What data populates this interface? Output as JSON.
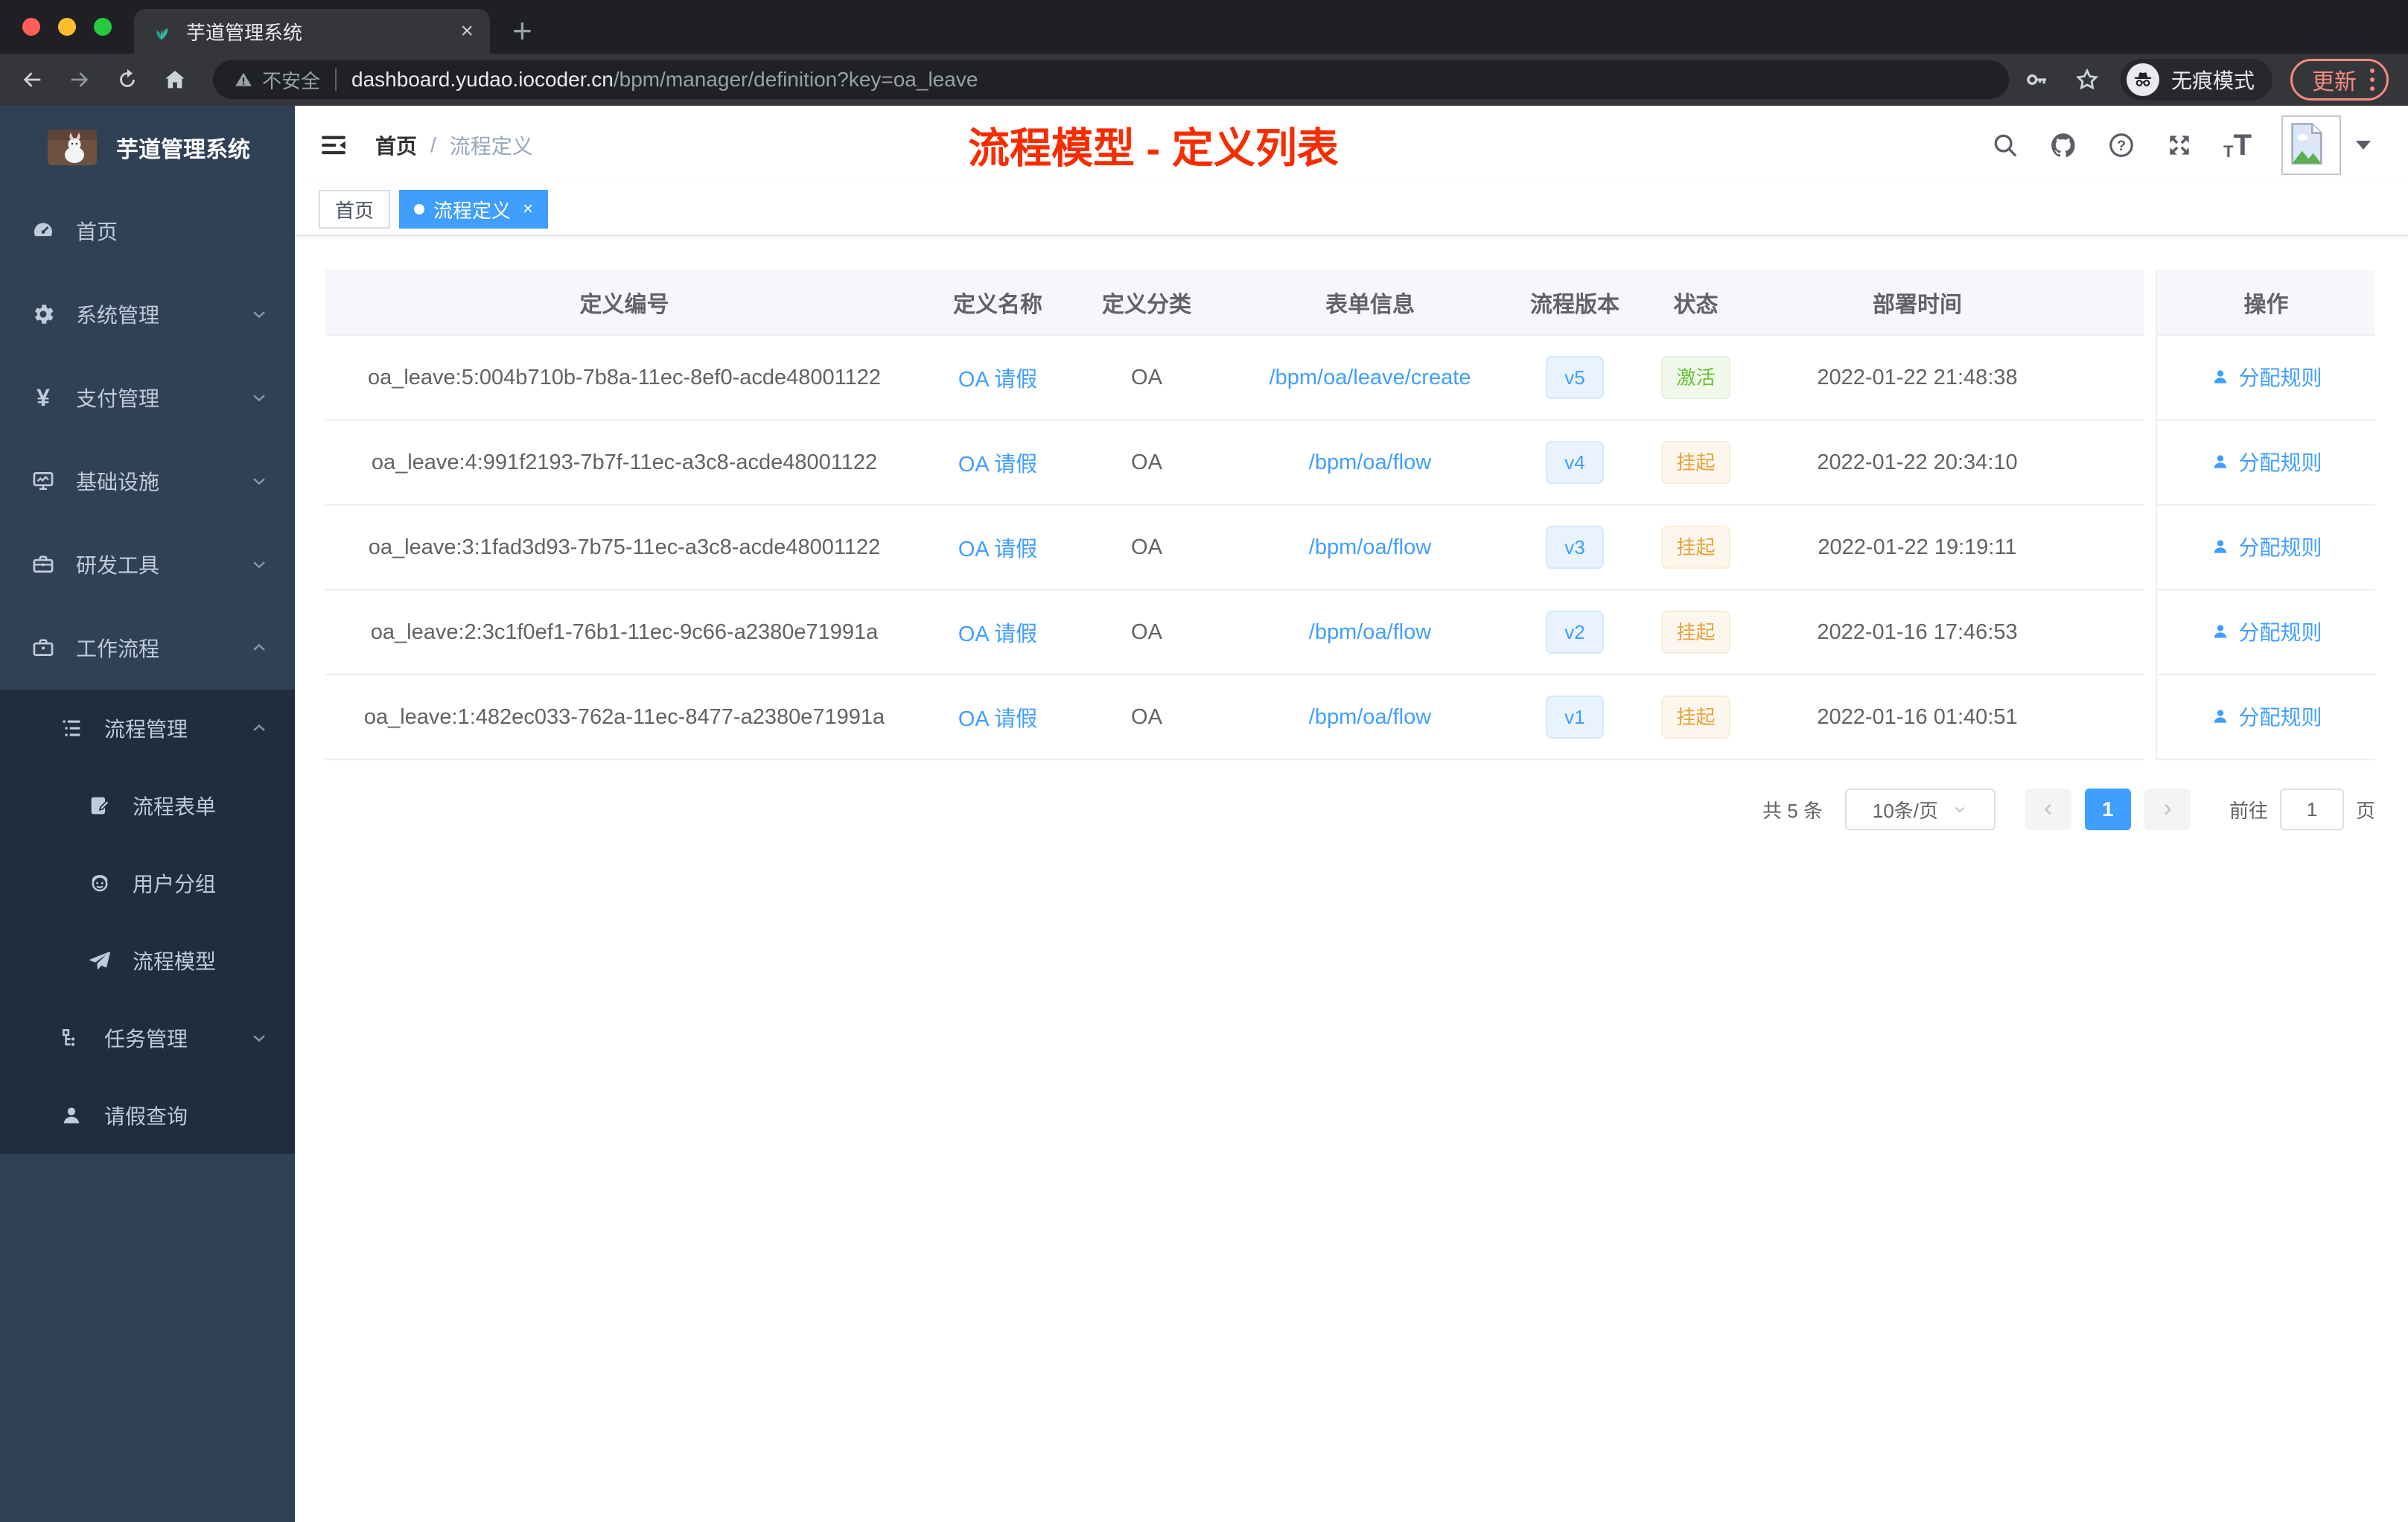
{
  "browser": {
    "tab_title": "芋道管理系统",
    "security_label": "不安全",
    "url_host": "dashboard.yudao.iocoder.cn",
    "url_path": "/bpm/manager/definition?key=oa_leave",
    "incognito_label": "无痕模式",
    "update_label": "更新"
  },
  "icons": {
    "close_glyph": "×",
    "plus_glyph": "+",
    "pay_glyph": "¥",
    "font_small": "T",
    "font_big": "T"
  },
  "sidebar": {
    "logo_title": "芋道管理系统",
    "items": {
      "home": "首页",
      "system": "系统管理",
      "pay": "支付管理",
      "infra": "基础设施",
      "dev": "研发工具",
      "workflow": "工作流程",
      "process_mgmt": "流程管理",
      "process_form": "流程表单",
      "user_group": "用户分组",
      "process_model": "流程模型",
      "task_mgmt": "任务管理",
      "leave_query": "请假查询"
    }
  },
  "header": {
    "breadcrumb_home": "首页",
    "breadcrumb_sep": "/",
    "breadcrumb_current": "流程定义",
    "annotation": "流程模型 - 定义列表"
  },
  "tags": {
    "home": "首页",
    "active": "流程定义"
  },
  "table": {
    "columns": {
      "id": "定义编号",
      "name": "定义名称",
      "category": "定义分类",
      "form": "表单信息",
      "version": "流程版本",
      "status": "状态",
      "deploy_time": "部署时间",
      "actions": "操作"
    },
    "rows": [
      {
        "id": "oa_leave:5:004b710b-7b8a-11ec-8ef0-acde48001122",
        "name": "OA 请假",
        "category": "OA",
        "form": "/bpm/oa/leave/create",
        "version": "v5",
        "status": "激活",
        "time": "2022-01-22 21:48:38",
        "action": "分配规则"
      },
      {
        "id": "oa_leave:4:991f2193-7b7f-11ec-a3c8-acde48001122",
        "name": "OA 请假",
        "category": "OA",
        "form": "/bpm/oa/flow",
        "version": "v4",
        "status": "挂起",
        "time": "2022-01-22 20:34:10",
        "action": "分配规则"
      },
      {
        "id": "oa_leave:3:1fad3d93-7b75-11ec-a3c8-acde48001122",
        "name": "OA 请假",
        "category": "OA",
        "form": "/bpm/oa/flow",
        "version": "v3",
        "status": "挂起",
        "time": "2022-01-22 19:19:11",
        "action": "分配规则"
      },
      {
        "id": "oa_leave:2:3c1f0ef1-76b1-11ec-9c66-a2380e71991a",
        "name": "OA 请假",
        "category": "OA",
        "form": "/bpm/oa/flow",
        "version": "v2",
        "status": "挂起",
        "time": "2022-01-16 17:46:53",
        "action": "分配规则"
      },
      {
        "id": "oa_leave:1:482ec033-762a-11ec-8477-a2380e71991a",
        "name": "OA 请假",
        "category": "OA",
        "form": "/bpm/oa/flow",
        "version": "v1",
        "status": "挂起",
        "time": "2022-01-16 01:40:51",
        "action": "分配规则"
      }
    ]
  },
  "pagination": {
    "total": "共 5 条",
    "page_size": "10条/页",
    "current": "1",
    "goto_label": "前往",
    "goto_value": "1",
    "page_unit": "页"
  },
  "colors": {
    "accent": "#409eff",
    "success": "#67c23a",
    "warning": "#e6a23c",
    "annotation_red": "#f72c00",
    "sidebar_bg": "#304156",
    "submenu_bg": "#1f2d3d"
  }
}
